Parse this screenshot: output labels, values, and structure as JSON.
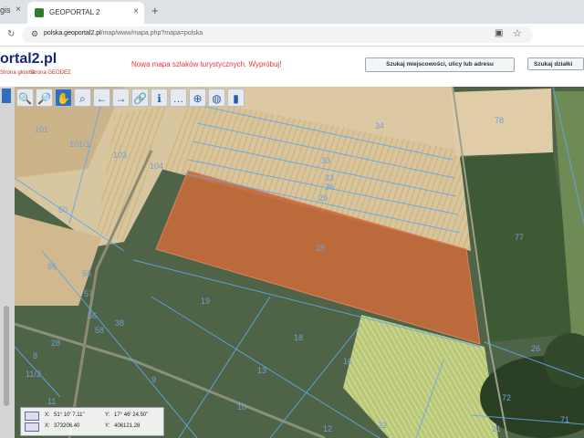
{
  "browser": {
    "prev_tab_fragment": "gis ×",
    "tab_title": "GEOPORTAL 2",
    "new_tab_symbol": "+",
    "url_domain": "polska.geoportal2.pl",
    "url_path": "/map/www/mapa.php?mapa=polska"
  },
  "header": {
    "logo_text": "ortal2.pl",
    "link_home": "Strona główna",
    "link_page": "Strona GEODEZ",
    "news": "Nowa mapa szlaków turystycznych. Wypróbuj!",
    "search_button": "Szukaj miejscowości, ulicy lub adresu",
    "search_button2": "Szukaj działki"
  },
  "toolbar": {
    "tools": [
      "zoom-in",
      "zoom-out",
      "pan",
      "zoom-window",
      "back",
      "forward",
      "link",
      "info",
      "measure",
      "center",
      "globe",
      "layers"
    ]
  },
  "coords": {
    "row1_label": "X:",
    "row1_value": "51° 10' 7.11\"",
    "row1_label2": "Y:",
    "row1_value2": "17° 46' 24.50\"",
    "row2_label": "X:",
    "row2_value": "373206.40",
    "row2_label2": "Y:",
    "row2_value2": "406121.28"
  },
  "parcels": [
    "34",
    "78",
    "101",
    "101/1",
    "103",
    "104",
    "33",
    "33",
    "36",
    "29",
    "28",
    "77",
    "96",
    "55",
    "19",
    "57",
    "56",
    "58",
    "18",
    "22",
    "10",
    "9",
    "8",
    "13",
    "12",
    "21",
    "16",
    "72",
    "71",
    "11",
    "28",
    "38",
    "11/2",
    "26",
    "50"
  ]
}
